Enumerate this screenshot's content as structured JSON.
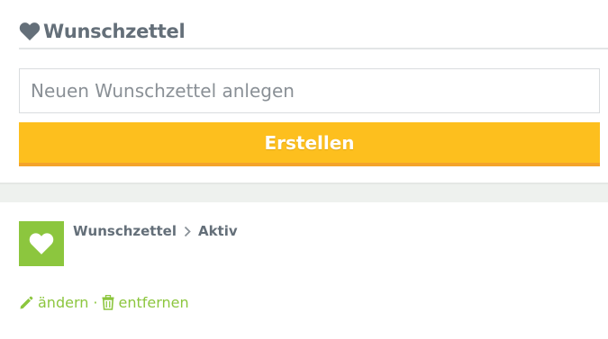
{
  "header": {
    "title": "Wunschzettel",
    "icon": "heart-icon"
  },
  "create_form": {
    "input_placeholder": "Neuen Wunschzettel anlegen",
    "input_value": "",
    "submit_label": "Erstellen"
  },
  "wishlist_item": {
    "thumbnail_icon": "heart-icon",
    "breadcrumb": [
      "Wunschzettel",
      "Aktiv"
    ],
    "actions": {
      "edit_label": "ändern",
      "separator": "·",
      "delete_label": "entfernen"
    }
  },
  "colors": {
    "accent_green": "#8cc63e",
    "button_yellow": "#fdbf1e",
    "button_border_orange": "#f4a32a",
    "title_gray": "#646f79"
  }
}
